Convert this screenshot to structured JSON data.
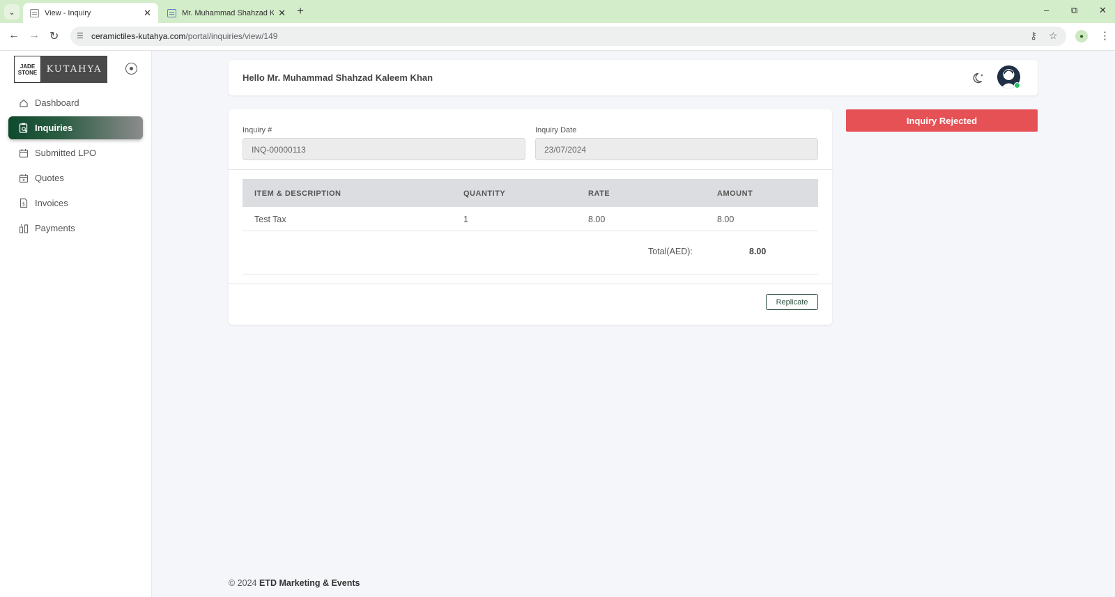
{
  "browser": {
    "tabs": [
      {
        "title": "View - Inquiry",
        "active": true
      },
      {
        "title": "Mr. Muhammad Shahzad Kaleem Khan",
        "active": false
      }
    ],
    "url_host": "ceramictiles-kutahya.com",
    "url_path": "/portal/inquiries/view/149"
  },
  "sidebar": {
    "logo": {
      "jade_line1": "JADE",
      "jade_line2": "STONE",
      "brand": "KUTAHYA"
    },
    "items": [
      {
        "label": "Dashboard",
        "icon": "home-icon",
        "active": false
      },
      {
        "label": "Inquiries",
        "icon": "clipboard-search-icon",
        "active": true
      },
      {
        "label": "Submitted LPO",
        "icon": "calendar-icon",
        "active": false
      },
      {
        "label": "Quotes",
        "icon": "calendar-plus-icon",
        "active": false
      },
      {
        "label": "Invoices",
        "icon": "file-dollar-icon",
        "active": false
      },
      {
        "label": "Payments",
        "icon": "payments-icon",
        "active": false
      }
    ]
  },
  "header": {
    "greeting": "Hello Mr. Muhammad Shahzad Kaleem Khan"
  },
  "inquiry": {
    "number_label": "Inquiry #",
    "number_value": "INQ-00000113",
    "date_label": "Inquiry Date",
    "date_value": "23/07/2024",
    "columns": [
      "ITEM & DESCRIPTION",
      "QUANTITY",
      "RATE",
      "AMOUNT"
    ],
    "rows": [
      {
        "item": "Test Tax",
        "quantity": "1",
        "rate": "8.00",
        "amount": "8.00"
      }
    ],
    "total_label": "Total(AED):",
    "total_value": "8.00",
    "replicate_label": "Replicate"
  },
  "status": {
    "label": "Inquiry Rejected",
    "color": "#e65156"
  },
  "footer": {
    "prefix": "© 2024",
    "company": "ETD Marketing & Events"
  },
  "colors": {
    "accent": "#0f4a2e",
    "tabbar": "#d3ecc9"
  }
}
